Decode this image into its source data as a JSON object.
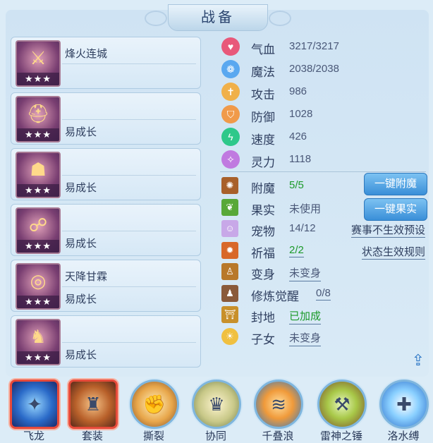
{
  "title": "战备",
  "equipment": [
    {
      "line1": "烽火连城",
      "line2": "",
      "stars": "★★★",
      "icon": "weapon-icon",
      "glyph": "⚔"
    },
    {
      "line1": "",
      "line2": "易成长",
      "stars": "★★★",
      "icon": "helmet-icon",
      "glyph": "⛑"
    },
    {
      "line1": "",
      "line2": "易成长",
      "stars": "★★★",
      "icon": "armor-icon",
      "glyph": "☗"
    },
    {
      "line1": "",
      "line2": "易成长",
      "stars": "★★★",
      "icon": "necklace-icon",
      "glyph": "☍"
    },
    {
      "line1": "天降甘霖",
      "line2": "易成长",
      "stars": "★★★",
      "icon": "belt-icon",
      "glyph": "◎"
    },
    {
      "line1": "",
      "line2": "易成长",
      "stars": "★★★",
      "icon": "boots-icon",
      "glyph": "♞"
    }
  ],
  "stats": [
    {
      "label": "气血",
      "value": "3217/3217",
      "icon": "heart-icon",
      "color": "#e8587a",
      "glyph": "♥"
    },
    {
      "label": "魔法",
      "value": "2038/2038",
      "icon": "mana-icon",
      "color": "#5aa8f0",
      "glyph": "❁"
    },
    {
      "label": "攻击",
      "value": "986",
      "icon": "attack-icon",
      "color": "#f0b04a",
      "glyph": "✝"
    },
    {
      "label": "防御",
      "value": "1028",
      "icon": "defense-icon",
      "color": "#f09a4a",
      "glyph": "⛉"
    },
    {
      "label": "速度",
      "value": "426",
      "icon": "speed-icon",
      "color": "#2ec88a",
      "glyph": "ϟ"
    },
    {
      "label": "灵力",
      "value": "1118",
      "icon": "spirit-icon",
      "color": "#c07ae0",
      "glyph": "✧"
    }
  ],
  "growth": [
    {
      "label": "附魔",
      "value": "5/5",
      "style": "green",
      "icon": "enchant-icon",
      "color": "#a8602a",
      "glyph": "✺"
    },
    {
      "label": "果实",
      "value": "未使用",
      "style": "plain",
      "icon": "fruit-icon",
      "color": "#58a838",
      "glyph": "❦"
    },
    {
      "label": "宠物",
      "value": "14/12",
      "style": "plain",
      "icon": "pet-icon",
      "color": "#c8a8e8",
      "glyph": "☺"
    },
    {
      "label": "祈福",
      "value": "2/2",
      "style": "green-u",
      "icon": "blessing-icon",
      "color": "#d8682a",
      "glyph": "✹"
    },
    {
      "label": "变身",
      "value": "未变身",
      "style": "u",
      "icon": "transform-icon",
      "color": "#b8782a",
      "glyph": "♙"
    },
    {
      "label": "修炼觉醒",
      "value": "0/8",
      "style": "u",
      "icon": "cultivation-icon",
      "color": "#8a5a3a",
      "glyph": "♟"
    },
    {
      "label": "封地",
      "value": "已加成",
      "style": "green-u",
      "icon": "fief-icon",
      "color": "#c8902a",
      "glyph": "⛩"
    },
    {
      "label": "子女",
      "value": "未变身",
      "style": "u",
      "icon": "children-icon",
      "color": "#f0c040",
      "glyph": "☀"
    }
  ],
  "buttons": {
    "enchant_all": "一键附魔",
    "fruit_all": "一键果实"
  },
  "links": {
    "event_preset": "赛事不生效预设",
    "status_rule": "状态生效规则"
  },
  "skills": [
    {
      "name": "飞龙",
      "icon": "flying-dragon-icon",
      "glyph": "✦",
      "frame": "square"
    },
    {
      "name": "套装",
      "icon": "suit-icon",
      "glyph": "♜",
      "frame": "square"
    },
    {
      "name": "撕裂",
      "icon": "tear-icon",
      "glyph": "✊",
      "frame": "round"
    },
    {
      "name": "协同",
      "icon": "cooperate-icon",
      "glyph": "♛",
      "frame": "round"
    },
    {
      "name": "千叠浪",
      "icon": "wave-icon",
      "glyph": "≋",
      "frame": "round"
    },
    {
      "name": "雷神之锤",
      "icon": "thor-hammer-icon",
      "glyph": "⚒",
      "frame": "round"
    },
    {
      "name": "洛水缚",
      "icon": "water-bind-icon",
      "glyph": "✚",
      "frame": "round"
    }
  ]
}
